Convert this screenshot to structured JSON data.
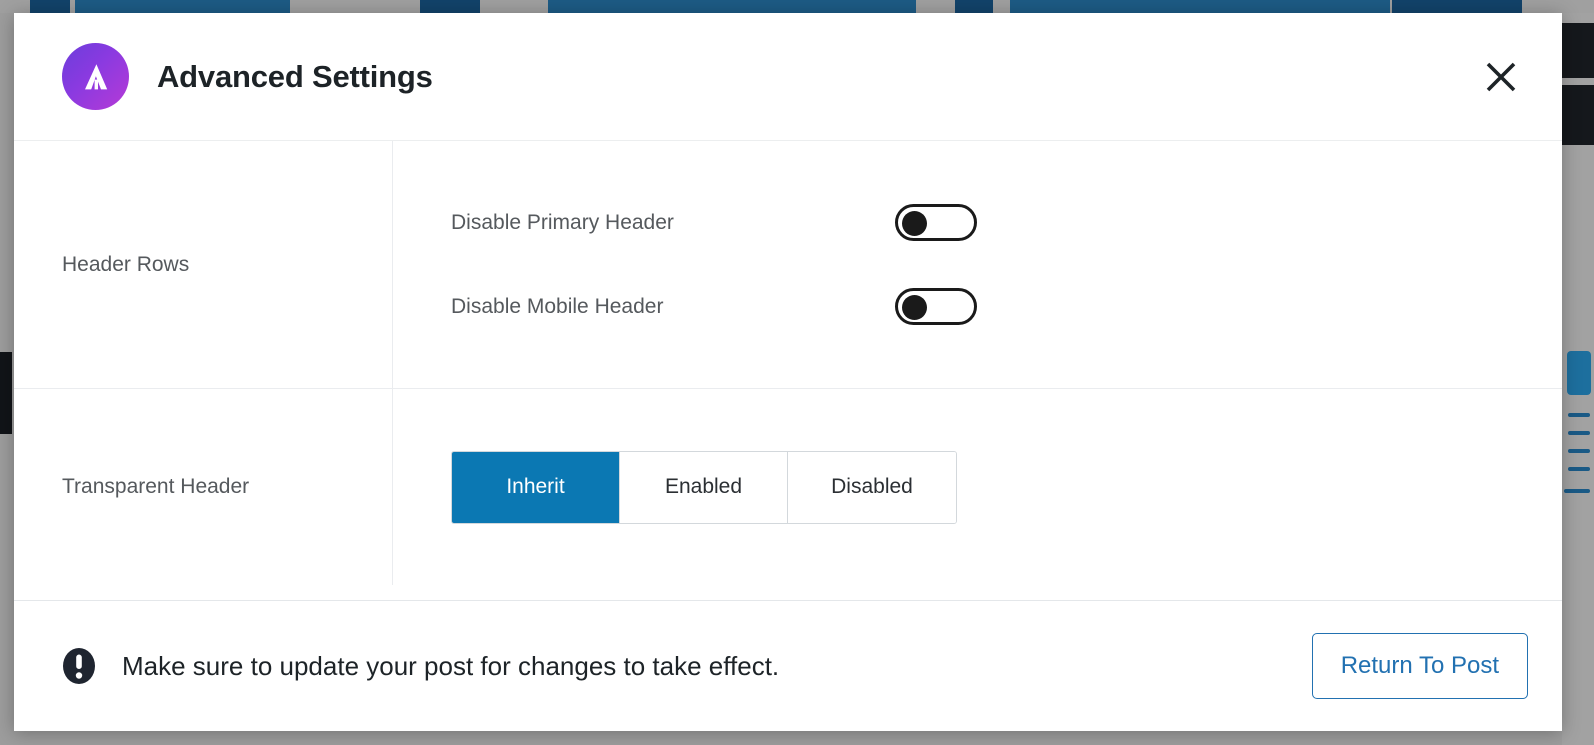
{
  "modal": {
    "title": "Advanced Settings",
    "logo_icon": "astra-logo-icon",
    "close_icon": "close-icon"
  },
  "sections": [
    {
      "label": "Header Rows",
      "type": "toggles",
      "fields": [
        {
          "label": "Disable Primary Header",
          "state": "off"
        },
        {
          "label": "Disable Mobile Header",
          "state": "off"
        }
      ]
    },
    {
      "label": "Transparent Header",
      "type": "button-group",
      "options": [
        {
          "label": "Inherit",
          "active": true
        },
        {
          "label": "Enabled",
          "active": false
        },
        {
          "label": "Disabled",
          "active": false
        }
      ]
    }
  ],
  "footer": {
    "notice_icon": "exclamation-circle-icon",
    "notice_text": "Make sure to update your post for changes to take effect.",
    "return_label": "Return To Post"
  },
  "colors": {
    "accent_blue": "#0b78b3",
    "link_blue": "#2271b1",
    "label_gray": "#55595d",
    "logo_gradient_start": "#6b3ddb",
    "logo_gradient_end": "#b63ad6"
  }
}
